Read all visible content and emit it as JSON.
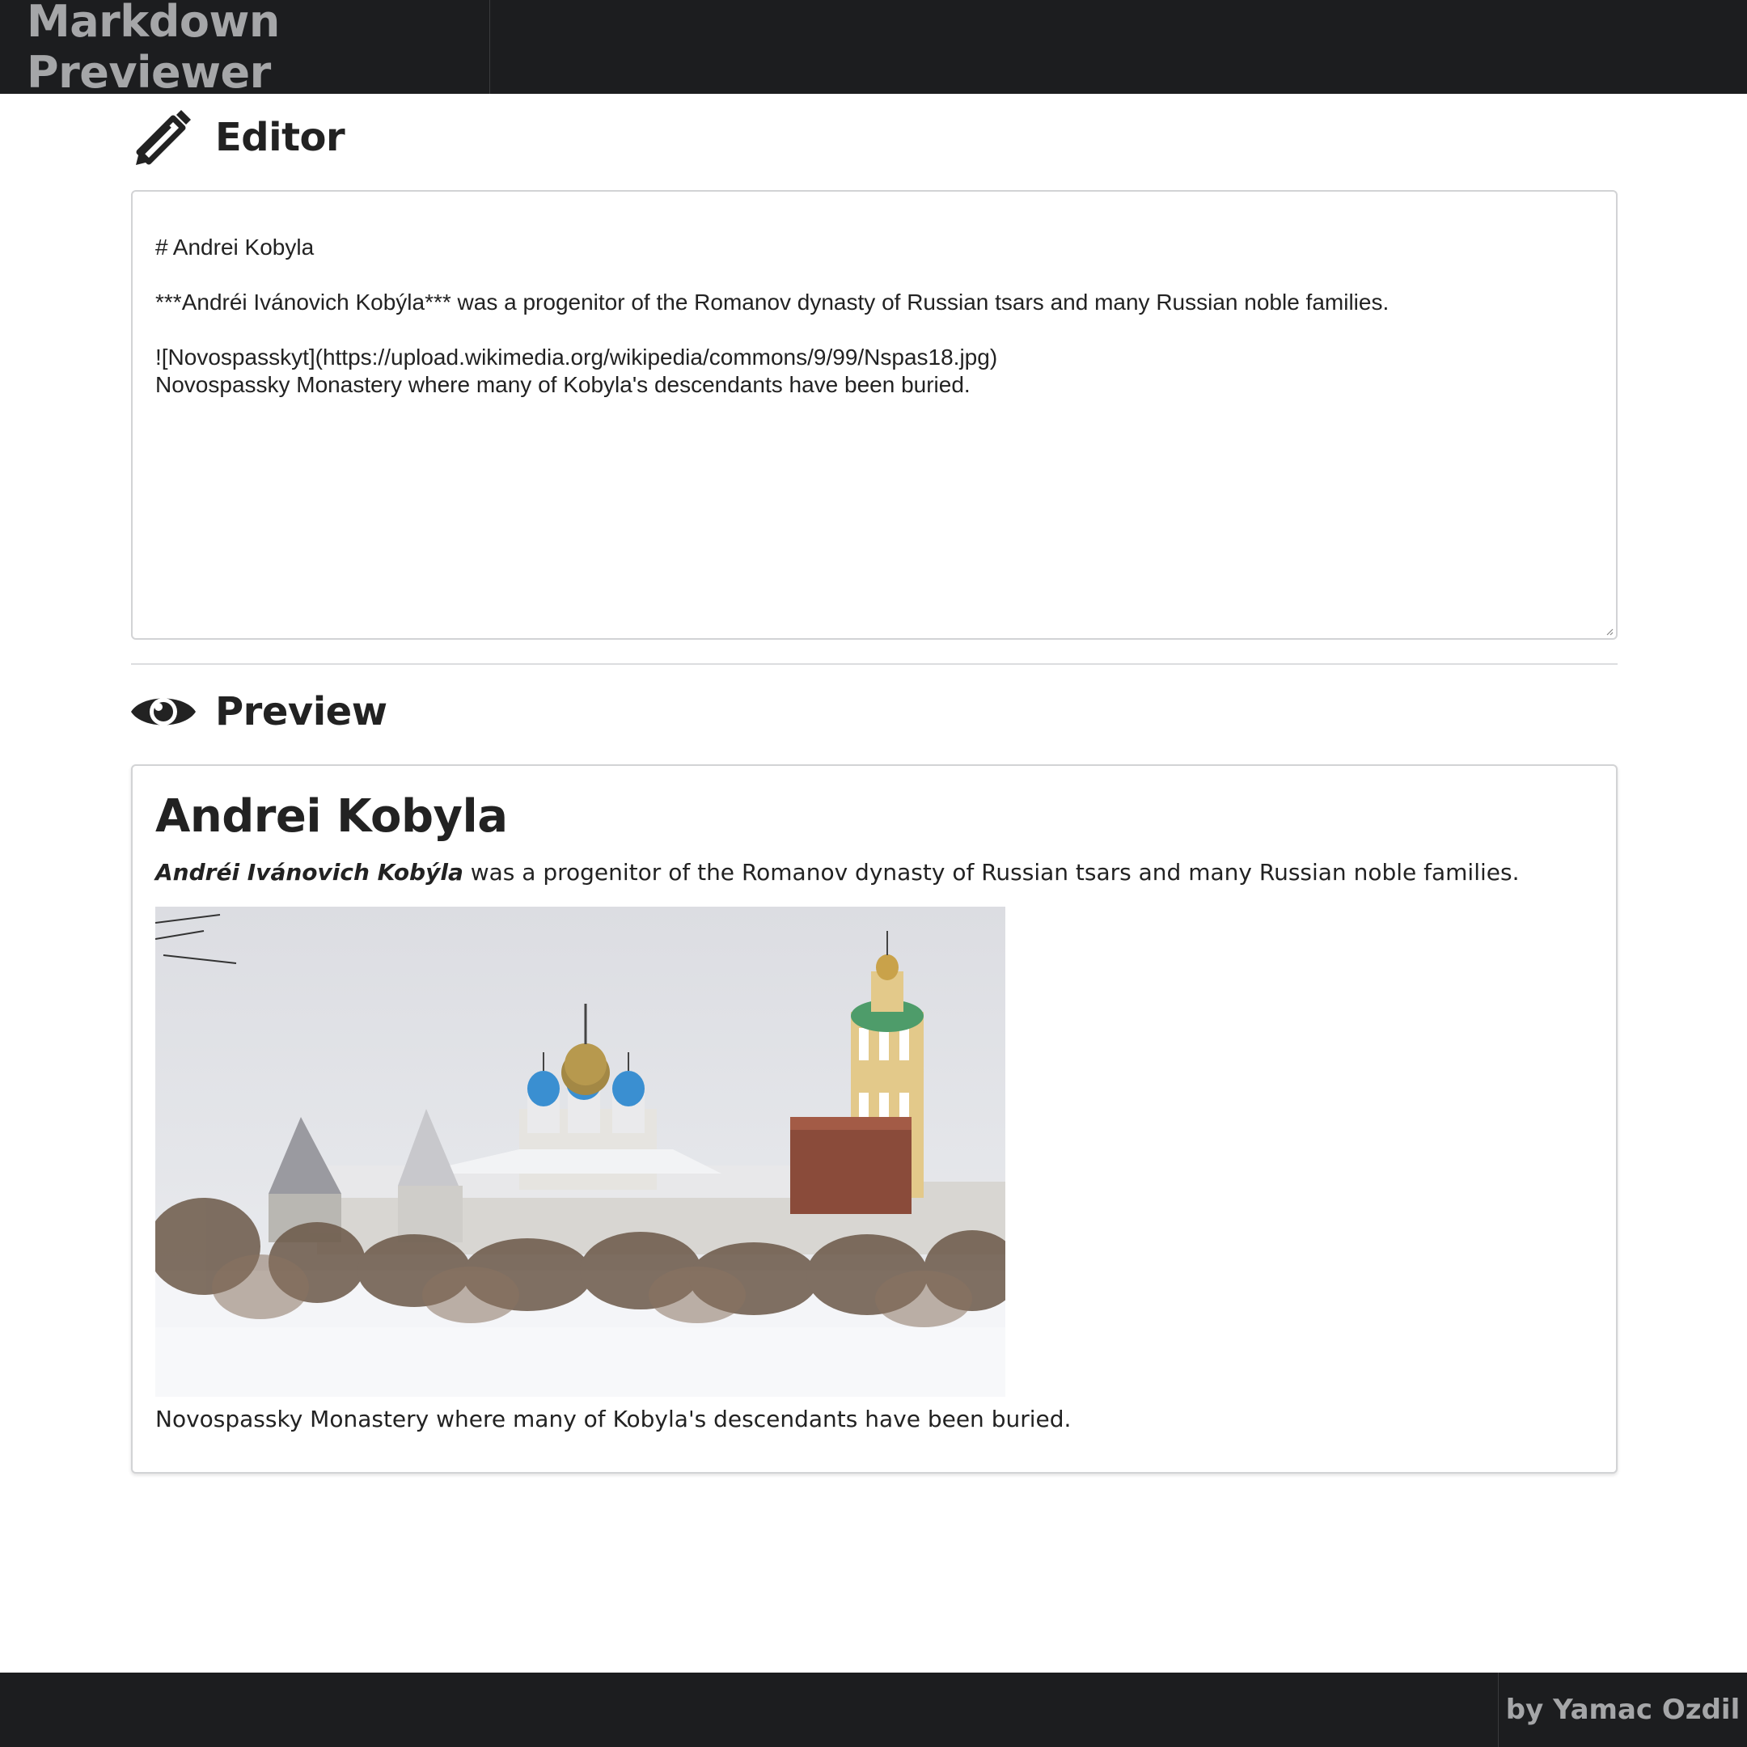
{
  "app": {
    "title": "Markdown Previewer"
  },
  "editor": {
    "heading": "Editor",
    "icon": "pencil-icon",
    "content": "# Andrei Kobyla\n\n***Andréi Ivánovich Kobýla*** was a progenitor of the Romanov dynasty of Russian tsars and many Russian noble families.\n\n![Novospasskyt](https://upload.wikimedia.org/wikipedia/commons/9/99/Nspas18.jpg)\nNovospassky Monastery where many of Kobyla's descendants have been buried."
  },
  "preview": {
    "heading": "Preview",
    "icon": "eye-icon",
    "title": "Andrei Kobyla",
    "lead_name": "Andréi Ivánovich Kobýla",
    "lead_rest": " was a progenitor of the Romanov dynasty of Russian tsars and many Russian noble families.",
    "image_alt": "Novospasskyt",
    "caption": "Novospassky Monastery where many of Kobyla's descendants have been buried."
  },
  "footer": {
    "credit": "by Yamac Ozdil"
  },
  "colors": {
    "navbar_bg": "#1c1d1f",
    "navbar_text": "#a5a6a8",
    "border": "#d2d3d5",
    "text": "#222222"
  }
}
